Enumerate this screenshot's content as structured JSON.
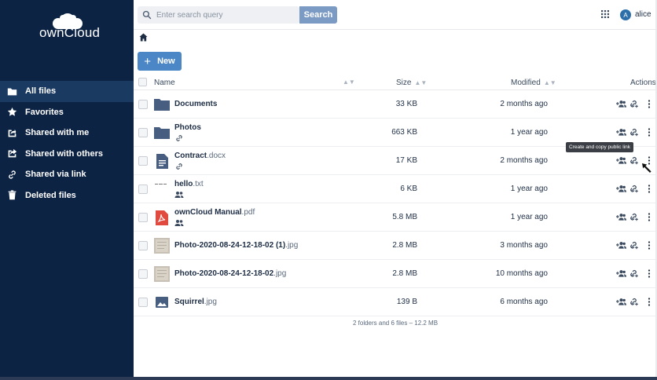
{
  "brand": {
    "name": "ownCloud",
    "logo_icon": "cloud-logo-icon"
  },
  "sidebar": {
    "items": [
      {
        "label": "All files",
        "icon": "folder-icon",
        "active": true
      },
      {
        "label": "Favorites",
        "icon": "star-icon",
        "active": false
      },
      {
        "label": "Shared with me",
        "icon": "share-in-icon",
        "active": false
      },
      {
        "label": "Shared with others",
        "icon": "share-out-icon",
        "active": false
      },
      {
        "label": "Shared via link",
        "icon": "link-icon",
        "active": false
      },
      {
        "label": "Deleted files",
        "icon": "trash-icon",
        "active": false
      }
    ]
  },
  "topbar": {
    "search_placeholder": "Enter search query",
    "search_button": "Search",
    "avatar_initial": "A",
    "username": "alice"
  },
  "toolbar": {
    "new_label": "New"
  },
  "table": {
    "headers": {
      "name": "Name",
      "size": "Size",
      "modified": "Modified",
      "actions": "Actions"
    },
    "rows": [
      {
        "base": "Documents",
        "ext": "",
        "type": "folder",
        "indicator": "",
        "size": "33 KB",
        "modified": "2 months ago"
      },
      {
        "base": "Photos",
        "ext": "",
        "type": "folder",
        "indicator": "link",
        "size": "663 KB",
        "modified": "1 year ago"
      },
      {
        "base": "Contract",
        "ext": ".docx",
        "type": "doc",
        "indicator": "link",
        "size": "17 KB",
        "modified": "2 months ago"
      },
      {
        "base": "hello",
        "ext": ".txt",
        "type": "txt",
        "indicator": "people",
        "size": "6 KB",
        "modified": "1 year ago"
      },
      {
        "base": "ownCloud Manual",
        "ext": ".pdf",
        "type": "pdf",
        "indicator": "people",
        "size": "5.8 MB",
        "modified": "1 year ago"
      },
      {
        "base": "Photo-2020-08-24-12-18-02 (1)",
        "ext": ".jpg",
        "type": "photo",
        "indicator": "",
        "size": "2.8 MB",
        "modified": "3 months ago"
      },
      {
        "base": "Photo-2020-08-24-12-18-02",
        "ext": ".jpg",
        "type": "photo",
        "indicator": "",
        "size": "2.8 MB",
        "modified": "10 months ago"
      },
      {
        "base": "Squirrel",
        "ext": ".jpg",
        "type": "image",
        "indicator": "",
        "size": "139 B",
        "modified": "6 months ago"
      }
    ],
    "summary": "2 folders and 6 files – 12.2 MB"
  },
  "tooltip": "Create and copy public link",
  "colors": {
    "sidebar": "#0d2344",
    "accent": "#4b87c6",
    "search_button": "#7b9ac4"
  }
}
